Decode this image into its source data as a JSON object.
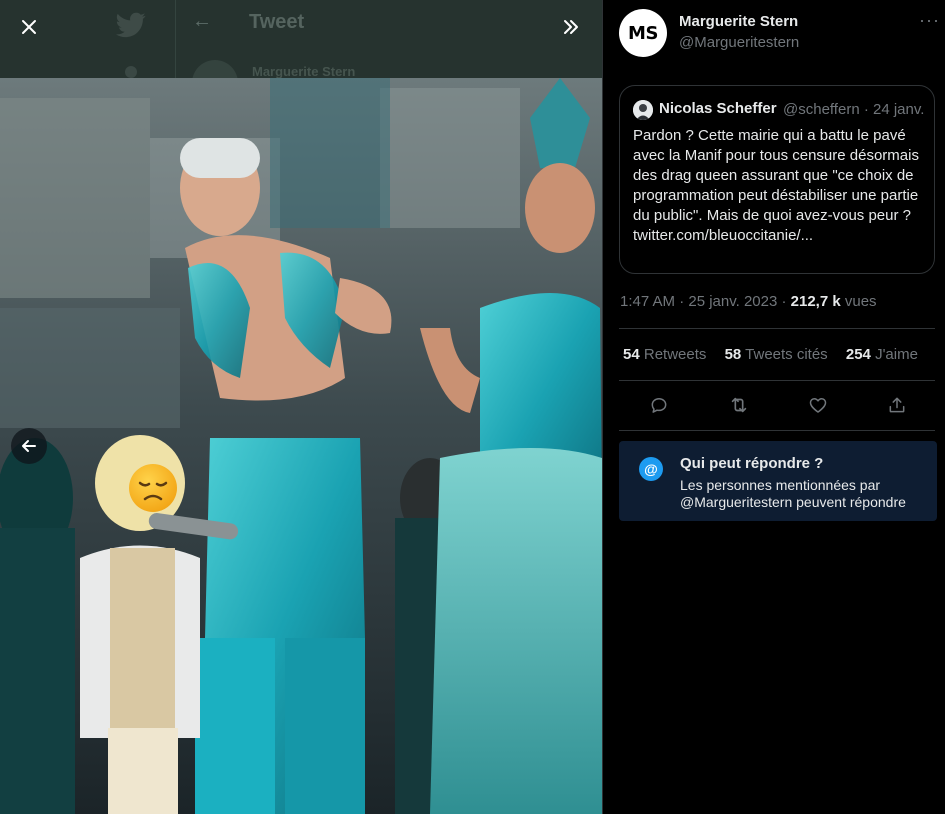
{
  "viewer": {
    "dimmed_header_title": "Tweet",
    "dimmed_author": "Marguerite Stern"
  },
  "author": {
    "initials": "MS",
    "name": "Marguerite Stern",
    "handle": "@Margueritestern"
  },
  "quoted_tweet": {
    "name": "Nicolas Scheffer",
    "handle": "@scheffern",
    "separator": "·",
    "date": "24 janv.",
    "text": "Pardon ? Cette mairie qui a battu le pavé avec la Manif pour tous censure désormais des drag queen assurant que \"ce choix de programmation peut déstabiliser une partie du public\". Mais de quoi avez-vous peur ? twitter.com/bleuoccitanie/..."
  },
  "meta": {
    "time_date": "1:47 AM · 25 janv. 2023 · ",
    "views_count": "212,7 k",
    "views_label": "vues"
  },
  "stats": [
    {
      "count": "54",
      "label": "Retweets"
    },
    {
      "count": "58",
      "label": "Tweets cités"
    },
    {
      "count": "254",
      "label": "J'aime"
    }
  ],
  "actions": [
    "reply-icon",
    "retweet-icon",
    "like-icon",
    "share-icon"
  ],
  "reply_restriction": {
    "icon_glyph": "@",
    "title": "Qui peut répondre ?",
    "body": "Les personnes mentionnées par @Margueritestern peuvent répondre"
  },
  "colors": {
    "accent": "#1d9bf0",
    "panel_bg": "#000000",
    "muted_text": "#71767b",
    "reply_box_bg": "#0e1d32"
  }
}
